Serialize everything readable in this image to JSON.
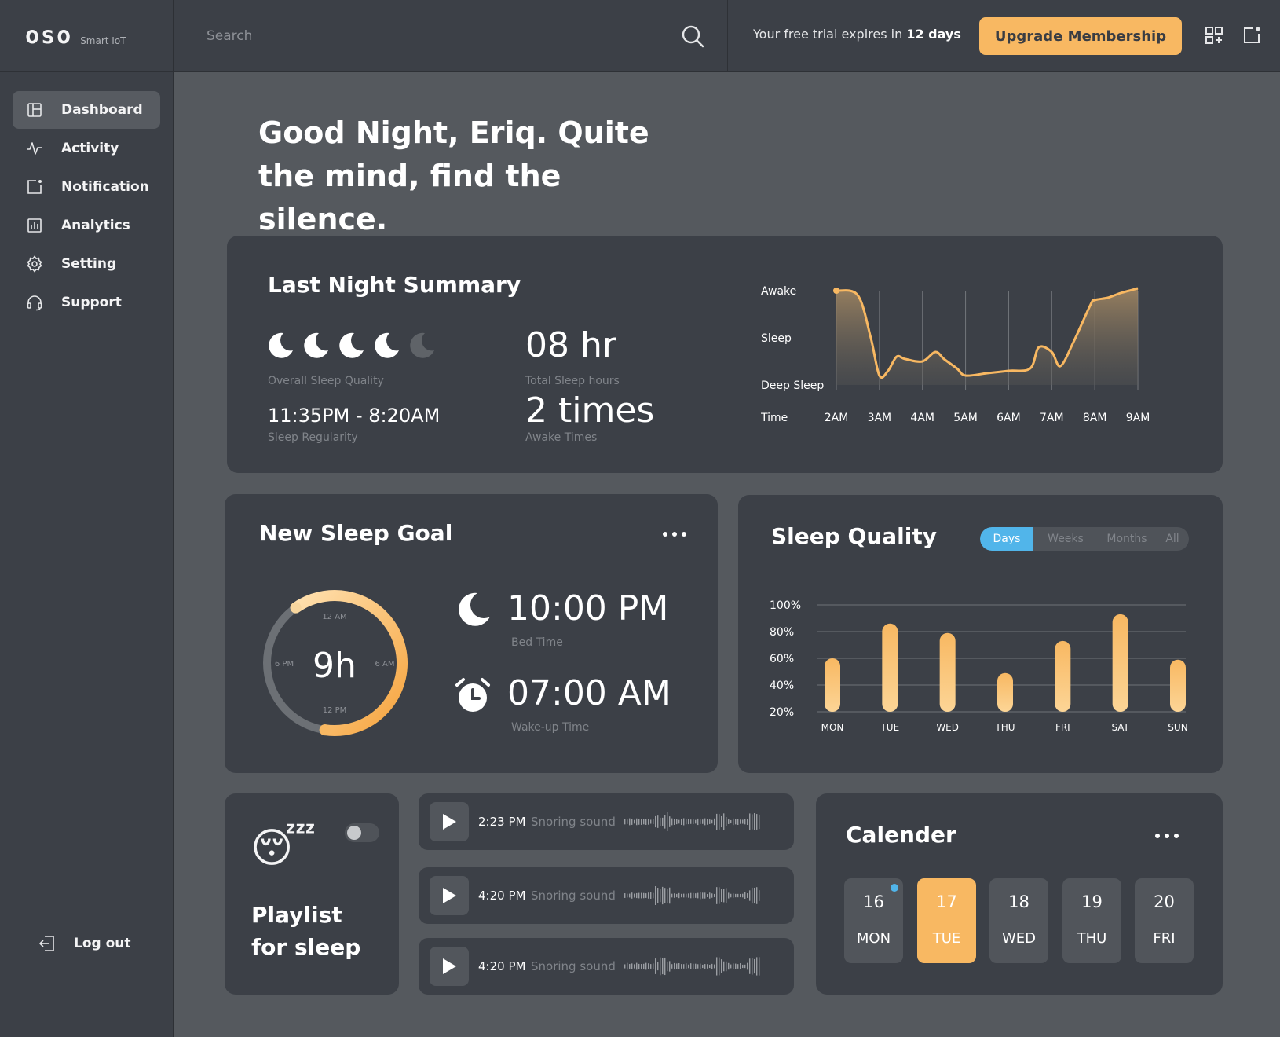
{
  "brand": {
    "logo": "oso",
    "subtitle": "Smart IoT"
  },
  "sidebar": {
    "items": [
      {
        "label": "Dashboard",
        "icon": "dashboard-icon",
        "active": true
      },
      {
        "label": "Activity",
        "icon": "activity-icon"
      },
      {
        "label": "Notification",
        "icon": "notification-icon"
      },
      {
        "label": "Analytics",
        "icon": "analytics-icon"
      },
      {
        "label": "Setting",
        "icon": "gear-icon"
      },
      {
        "label": "Support",
        "icon": "headset-icon"
      }
    ],
    "logout_label": "Log out"
  },
  "topbar": {
    "search_placeholder": "Search",
    "trial_prefix": "Your free trial expires in ",
    "trial_days": "12 days",
    "upgrade_label": "Upgrade Membership"
  },
  "greeting": {
    "line1": "Good Night, Eriq. Quite",
    "line2": "the mind, find the silence."
  },
  "summary": {
    "title": "Last Night Summary",
    "quality_label": "Overall Sleep Quality",
    "moons_filled": 4,
    "moons_total": 5,
    "regularity_value": "11:35PM - 8:20AM",
    "regularity_label": "Sleep Regularity",
    "total_hours_value": "08 hr",
    "total_hours_label": "Total Sleep hours",
    "awake_value": "2 times",
    "awake_label": "Awake Times",
    "chart_data": {
      "type": "area",
      "y_categories": [
        "Awake",
        "Sleep",
        "Deep Sleep"
      ],
      "x_label": "Time",
      "x_ticks": [
        "2AM",
        "3AM",
        "4AM",
        "5AM",
        "6AM",
        "7AM",
        "8AM",
        "9AM"
      ],
      "x": [
        2.0,
        2.5,
        2.8,
        3.0,
        3.2,
        3.4,
        3.6,
        4.0,
        4.3,
        4.5,
        4.8,
        5.0,
        5.5,
        6.0,
        6.5,
        6.7,
        7.0,
        7.2,
        7.5,
        7.9,
        8.0,
        8.3,
        8.6,
        9.0
      ],
      "y": [
        2.0,
        1.9,
        1.0,
        0.2,
        0.3,
        0.6,
        0.55,
        0.5,
        0.7,
        0.55,
        0.35,
        0.2,
        0.25,
        0.3,
        0.35,
        0.8,
        0.7,
        0.4,
        0.9,
        1.7,
        1.8,
        1.85,
        1.95,
        2.05
      ],
      "ylim": [
        0,
        2
      ],
      "grid": "vertical"
    }
  },
  "goal": {
    "title": "New Sleep Goal",
    "hours": "9h",
    "dial_labels": {
      "top": "12 AM",
      "left": "6 PM",
      "right": "6 AM",
      "bottom": "12 PM"
    },
    "progress": 0.62,
    "bed_time": "10:00 PM",
    "bed_time_label": "Bed Time",
    "wake_time": "07:00 AM",
    "wake_time_label": "Wake-up Time"
  },
  "quality": {
    "title": "Sleep Quality",
    "tabs": [
      "Days",
      "Weeks",
      "Months",
      "All"
    ],
    "active_tab": "Days",
    "chart_data": {
      "type": "bar",
      "categories": [
        "MON",
        "TUE",
        "WED",
        "THU",
        "FRI",
        "SAT",
        "SUN"
      ],
      "values": [
        60,
        86,
        79,
        49,
        73,
        93,
        59
      ],
      "yticks": [
        "100%",
        "80%",
        "60%",
        "40%",
        "20%"
      ],
      "ylim": [
        20,
        100
      ],
      "grid": true
    }
  },
  "playlist": {
    "line1": "Playlist",
    "line2": "for sleep",
    "emoji": "😴",
    "toggle_on": false
  },
  "recordings": [
    {
      "time": "2:23 PM",
      "label": "Snoring sound"
    },
    {
      "time": "4:20 PM",
      "label": "Snoring sound"
    },
    {
      "time": "4:20 PM",
      "label": "Snoring sound"
    }
  ],
  "calendar": {
    "title": "Calender",
    "days": [
      {
        "num": "16",
        "wk": "MON",
        "dot": true
      },
      {
        "num": "17",
        "wk": "TUE",
        "selected": true
      },
      {
        "num": "18",
        "wk": "WED"
      },
      {
        "num": "19",
        "wk": "THU"
      },
      {
        "num": "20",
        "wk": "FRI"
      }
    ]
  },
  "colors": {
    "accent": "#f8b862",
    "blue": "#51b5ea",
    "card": "#3c4047",
    "bg": "#55595e"
  }
}
